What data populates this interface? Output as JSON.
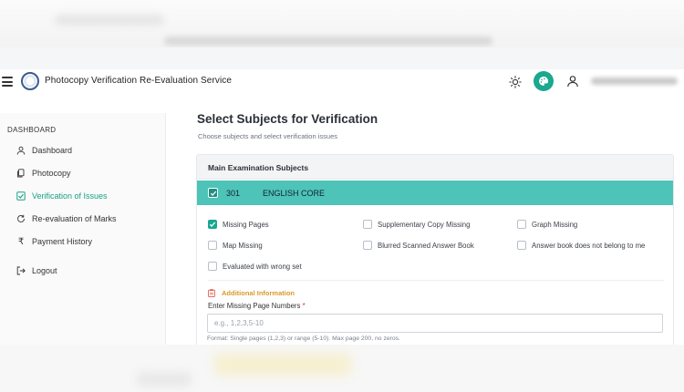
{
  "header": {
    "app_title": "Photocopy Verification Re-Evaluation Service",
    "icons": [
      "menu-icon",
      "sun-icon",
      "theme-icon",
      "user-icon"
    ],
    "accent_color": "#1aa88f"
  },
  "sidebar": {
    "heading": "DASHBOARD",
    "items": [
      {
        "label": "Dashboard",
        "icon": "user-icon",
        "active": false
      },
      {
        "label": "Photocopy",
        "icon": "copy-icon",
        "active": false
      },
      {
        "label": "Verification of Issues",
        "icon": "check-square-icon",
        "active": true
      },
      {
        "label": "Re-evaluation of Marks",
        "icon": "refresh-icon",
        "active": false
      },
      {
        "label": "Payment History",
        "icon": "rupee-icon",
        "active": false
      },
      {
        "label": "Logout",
        "icon": "logout-icon",
        "active": false
      }
    ]
  },
  "main": {
    "title": "Select Subjects for Verification",
    "subtitle": "Choose subjects and select verification issues",
    "section_label": "Main Examination Subjects",
    "subject": {
      "code": "301",
      "name": "ENGLISH CORE",
      "checked": true,
      "color": "#4ec3b7"
    },
    "issues": [
      {
        "label": "Missing Pages",
        "checked": true
      },
      {
        "label": "Supplementary Copy Missing",
        "checked": false
      },
      {
        "label": "Graph Missing",
        "checked": false
      },
      {
        "label": "Map Missing",
        "checked": false
      },
      {
        "label": "Blurred Scanned Answer Book",
        "checked": false
      },
      {
        "label": "Answer book does not belong to me",
        "checked": false
      },
      {
        "label": "Evaluated with wrong set",
        "checked": false
      }
    ],
    "additional_title": "Additional Information",
    "input_label": "Enter Missing Page Numbers",
    "input_required": "*",
    "input_placeholder": "e.g., 1,2,3,5-10",
    "input_value": "",
    "format_help": "Format: Single pages (1,2,3) or range (5-10). Max page 200, no zeros."
  }
}
